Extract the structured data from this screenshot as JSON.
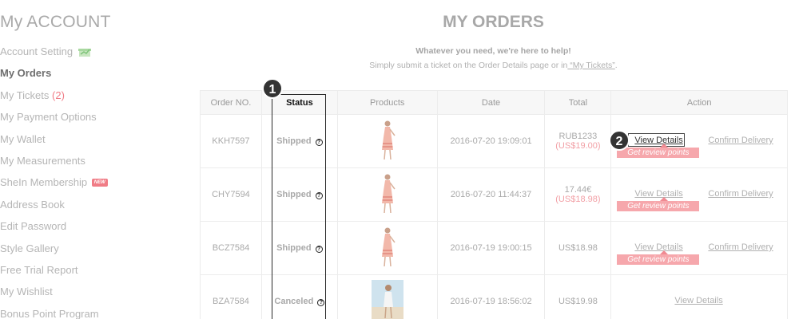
{
  "sidebar": {
    "title": "My ACCOUNT",
    "items": [
      {
        "label": "Account Setting",
        "icon": "gift-icon"
      },
      {
        "label": "My Orders",
        "active": true
      },
      {
        "label": "My Tickets",
        "count": "(2)"
      },
      {
        "label": "My Payment Options"
      },
      {
        "label": "My Wallet"
      },
      {
        "label": "My Measurements"
      },
      {
        "label": "SheIn Membership",
        "badge": "NEW"
      },
      {
        "label": "Address Book"
      },
      {
        "label": "Edit Password"
      },
      {
        "label": "Style Gallery"
      },
      {
        "label": "Free Trial Report"
      },
      {
        "label": "My Wishlist"
      },
      {
        "label": "Bonus Point Program"
      }
    ]
  },
  "main": {
    "title": "MY ORDERS",
    "help_line1": "Whatever you need, we're here to help!",
    "help_line2": "Simply submit a ticket on the Order Details page or in",
    "help_link": " “My Tickets”",
    "help_end": "."
  },
  "table": {
    "headers": [
      "Order NO.",
      "Status",
      "Products",
      "Date",
      "Total",
      "Action"
    ],
    "rows": [
      {
        "order": "KKH7597",
        "status": "Shipped",
        "date": "2016-07-20 19:09:01",
        "total1": "RUB1233",
        "total2": "(US$19.00)",
        "view": "View Details",
        "confirm": "Confirm Delivery",
        "review": "Get review points"
      },
      {
        "order": "CHY7594",
        "status": "Shipped",
        "date": "2016-07-20 11:44:37",
        "total1": "17.44€",
        "total2": "(US$18.98)",
        "view": "View Details",
        "confirm": "Confirm Delivery",
        "review": "Get review points"
      },
      {
        "order": "BCZ7584",
        "status": "Shipped",
        "date": "2016-07-19 19:00:15",
        "total1": "US$18.98",
        "total2": "",
        "view": "View Details",
        "confirm": "Confirm Delivery",
        "review": "Get review points"
      },
      {
        "order": "BZA7584",
        "status": "Canceled",
        "date": "2016-07-19 18:56:02",
        "total1": "US$19.98",
        "total2": "",
        "view": "View Details"
      }
    ],
    "help_glyph": "?"
  },
  "markers": {
    "m1": "1",
    "m2": "2"
  },
  "colors": {
    "accent_pink": "#f07c86",
    "review_badge": "#f6a7ac"
  }
}
